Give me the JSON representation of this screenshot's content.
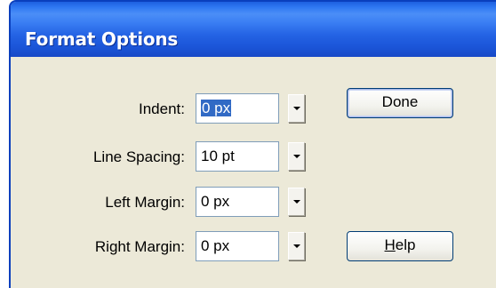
{
  "window": {
    "title": "Format Options"
  },
  "rows": [
    {
      "label": "Indent:",
      "value": "0 px"
    },
    {
      "label": "Line Spacing:",
      "value": "10 pt"
    },
    {
      "label": "Left Margin:",
      "value": "0 px"
    },
    {
      "label": "Right Margin:",
      "value": "0 px"
    }
  ],
  "buttons": {
    "done_label": "Done",
    "help_mnemonic": "H",
    "help_rest": "elp"
  },
  "icons": {
    "dropdown": "chevron-down-icon"
  },
  "colors": {
    "titlebar": "#2463e4",
    "window_bg": "#ece9d8",
    "selection": "#316ac5"
  }
}
